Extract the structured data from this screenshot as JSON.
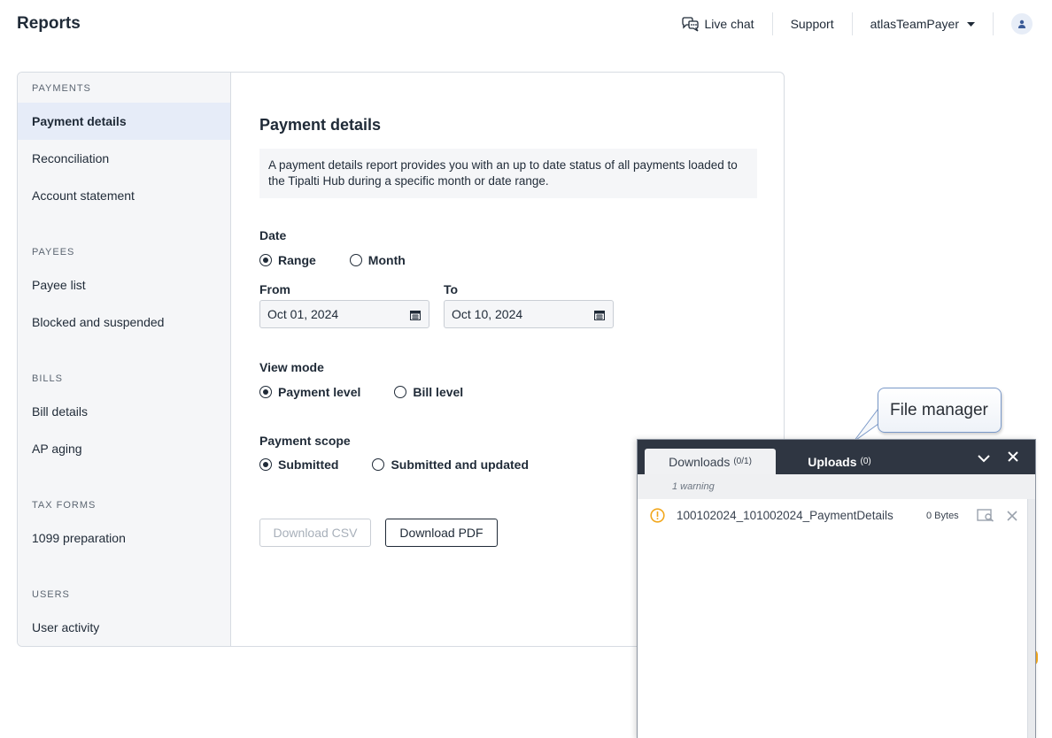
{
  "page": {
    "title": "Reports"
  },
  "topnav": {
    "live_chat": "Live chat",
    "support": "Support",
    "account": "atlasTeamPayer"
  },
  "sidebar": {
    "sections": [
      {
        "label": "PAYMENTS",
        "items": [
          "Payment details",
          "Reconciliation",
          "Account statement"
        ]
      },
      {
        "label": "PAYEES",
        "items": [
          "Payee list",
          "Blocked and suspended"
        ]
      },
      {
        "label": "BILLS",
        "items": [
          "Bill details",
          "AP aging"
        ]
      },
      {
        "label": "TAX FORMS",
        "items": [
          "1099 preparation"
        ]
      },
      {
        "label": "USERS",
        "items": [
          "User activity"
        ]
      }
    ],
    "active_item": "Payment details"
  },
  "main": {
    "heading": "Payment details",
    "info": "A payment details report provides you with an up to date status of all payments loaded to the Tipalti Hub during a specific month or date range.",
    "date": {
      "label": "Date",
      "options": [
        "Range",
        "Month"
      ],
      "selected": "Range",
      "from_label": "From",
      "from_value": "Oct 01, 2024",
      "to_label": "To",
      "to_value": "Oct 10, 2024"
    },
    "view_mode": {
      "label": "View mode",
      "options": [
        "Payment level",
        "Bill level"
      ],
      "selected": "Payment level"
    },
    "payment_scope": {
      "label": "Payment scope",
      "options": [
        "Submitted",
        "Submitted and updated"
      ],
      "selected": "Submitted"
    },
    "buttons": {
      "csv": "Download CSV",
      "pdf": "Download PDF"
    }
  },
  "callout": {
    "text": "File manager"
  },
  "file_manager": {
    "tabs": [
      {
        "label": "Downloads",
        "count": "(0/1)"
      },
      {
        "label": "Uploads",
        "count": "(0)"
      }
    ],
    "active_tab": "Downloads",
    "warning_summary": "1 warning",
    "files": [
      {
        "name": "100102024_101002024_PaymentDetails",
        "size": "0 Bytes",
        "status": "warning"
      }
    ]
  },
  "colors": {
    "active_nav": "#e6ecf8",
    "dark_header": "#2f3642",
    "warning": "#f2a71c"
  }
}
